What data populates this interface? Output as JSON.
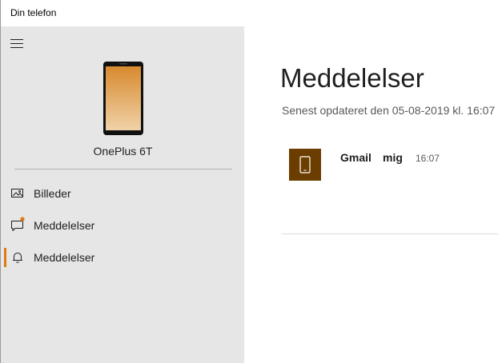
{
  "window": {
    "title": "Din telefon"
  },
  "sidebar": {
    "device_name": "OnePlus 6T",
    "items": [
      {
        "label": "Billeder",
        "icon": "photos-icon",
        "active": false,
        "badge": false
      },
      {
        "label": "Meddelelser",
        "icon": "messages-icon",
        "active": false,
        "badge": true
      },
      {
        "label": "Meddelelser",
        "icon": "bell-icon",
        "active": true,
        "badge": false
      }
    ]
  },
  "main": {
    "title": "Meddelelser",
    "last_updated": "Senest opdateret den 05-08-2019 kl. 16:07",
    "notifications": [
      {
        "app": "Gmail",
        "sender": "mig",
        "time": "16:07",
        "icon": "phone-icon"
      }
    ]
  },
  "colors": {
    "sidebar_bg": "#e6e6e6",
    "accent": "#e07a10",
    "app_tile": "#6b3e00",
    "badge": "#e07a10"
  }
}
